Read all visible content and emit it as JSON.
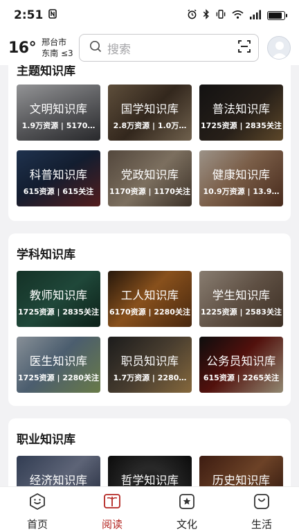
{
  "status_bar": {
    "time": "2:51",
    "icons": [
      "nfc-icon",
      "alarm-icon",
      "bluetooth-icon",
      "vibrate-icon",
      "wifi-icon",
      "signal-icon",
      "battery-charging-icon"
    ]
  },
  "header": {
    "temperature": "16°",
    "city": "邢台市",
    "wind": "东南 ≤3",
    "search_placeholder": "搜索"
  },
  "sections": [
    {
      "title": "主题知识库",
      "cards": [
        {
          "title": "文明知识库",
          "sub": "1.9万资源 | 5170…"
        },
        {
          "title": "国学知识库",
          "sub": "2.8万资源 | 1.0万…"
        },
        {
          "title": "普法知识库",
          "sub": "1725资源 | 2835关注"
        },
        {
          "title": "科普知识库",
          "sub": "615资源 | 615关注"
        },
        {
          "title": "党政知识库",
          "sub": "1170资源 | 1170关注"
        },
        {
          "title": "健康知识库",
          "sub": "10.9万资源 | 13.9…"
        }
      ]
    },
    {
      "title": "学科知识库",
      "cards": [
        {
          "title": "教师知识库",
          "sub": "1725资源 | 2835关注"
        },
        {
          "title": "工人知识库",
          "sub": "6170资源 | 2280关注"
        },
        {
          "title": "学生知识库",
          "sub": "1225资源 | 2583关注"
        },
        {
          "title": "医生知识库",
          "sub": "1725资源 | 2280关注"
        },
        {
          "title": "职员知识库",
          "sub": "1.7万资源 | 2280…"
        },
        {
          "title": "公务员知识库",
          "sub": "615资源 | 2265关注"
        }
      ]
    },
    {
      "title": "职业知识库",
      "cards": [
        {
          "title": "经济知识库",
          "sub": ""
        },
        {
          "title": "哲学知识库",
          "sub": ""
        },
        {
          "title": "历史知识库",
          "sub": ""
        }
      ]
    }
  ],
  "bottom_nav": [
    {
      "label": "首页",
      "icon": "home-hexagon-icon",
      "active": false
    },
    {
      "label": "阅读",
      "icon": "book-icon",
      "active": true
    },
    {
      "label": "文化",
      "icon": "star-badge-icon",
      "active": false
    },
    {
      "label": "生活",
      "icon": "bag-icon",
      "active": false
    }
  ],
  "colors": {
    "accent": "#b3231f",
    "background": "#f2f2f4",
    "card_bg": "#ffffff"
  }
}
